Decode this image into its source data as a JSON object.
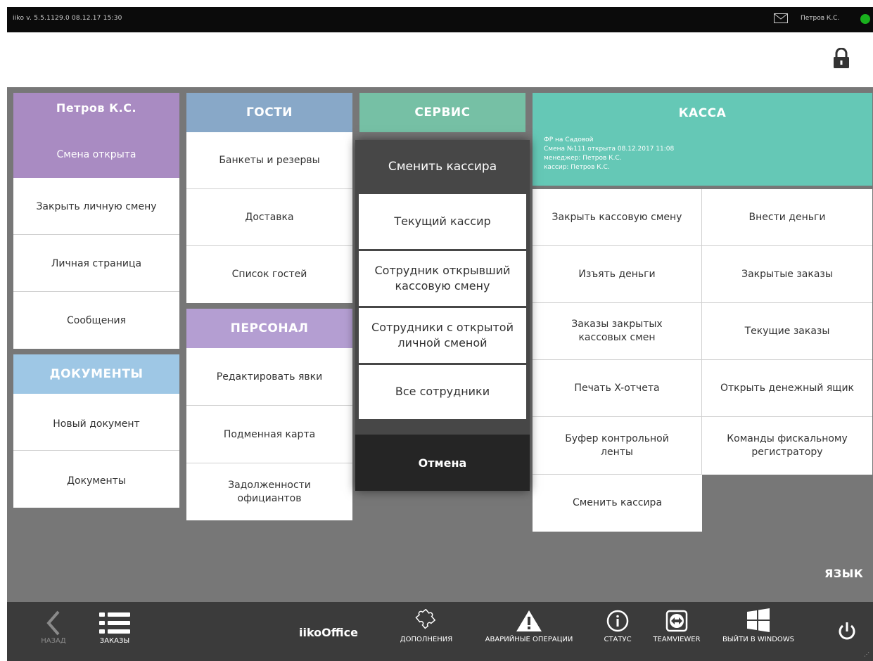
{
  "titlebar": {
    "version": "iiko v. 5.5.1129.0    08.12.17  15:30",
    "user": "Петров К.С.",
    "status_color": "#19b01d"
  },
  "colors": {
    "profile": "#a98bc2",
    "guests": "#88a8c8",
    "service": "#76c0a5",
    "kassa": "#65c8b6",
    "personnel": "#b49ed2",
    "documents": "#9ec7e5"
  },
  "profile": {
    "name": "Петров К.С.",
    "shift": "Смена открыта",
    "items": [
      "Закрыть личную смену",
      "Личная страница",
      "Сообщения"
    ]
  },
  "documents": {
    "title": "ДОКУМЕНТЫ",
    "items": [
      "Новый документ",
      "Документы"
    ]
  },
  "guests": {
    "title": "ГОСТИ",
    "items": [
      "Банкеты и резервы",
      "Доставка",
      "Список гостей"
    ]
  },
  "personnel": {
    "title": "ПЕРСОНАЛ",
    "items": [
      "Редактировать явки",
      "Подменная карта",
      "Задолженности официантов"
    ]
  },
  "service": {
    "title": "СЕРВИС"
  },
  "kassa": {
    "title": "КАССА",
    "info": [
      "ФР на Садовой",
      "Смена №111 открыта 08.12.2017 11:08",
      "менеджер: Петров К.С.",
      "кассир: Петров К.С."
    ],
    "left_items": [
      "Закрыть кассовую смену",
      "Изъять деньги",
      "Заказы закрытых кассовых смен",
      "Печать X-отчета",
      "Буфер контрольной ленты",
      "Сменить кассира"
    ],
    "right_items": [
      "Внести деньги",
      "Закрытые заказы",
      "Текущие заказы",
      "Открыть денежный ящик",
      "Команды фискальному регистратору"
    ]
  },
  "modal": {
    "title": "Сменить кассира",
    "options": [
      "Текущий кассир",
      "Сотрудник открывший кассовую смену",
      "Сотрудники с открытой личной сменой",
      "Все сотрудники"
    ],
    "cancel": "Отмена"
  },
  "language_label": "ЯЗЫК",
  "bottombar": {
    "back": "НАЗАД",
    "orders": "ЗАКАЗЫ",
    "brand": "iikoOffice",
    "addons": "ДОПОЛНЕНИЯ",
    "emergency": "АВАРИЙНЫЕ ОПЕРАЦИИ",
    "status": "СТАТУС",
    "teamviewer": "TEAMVIEWER",
    "exit_windows": "ВЫЙТИ В WINDOWS"
  }
}
